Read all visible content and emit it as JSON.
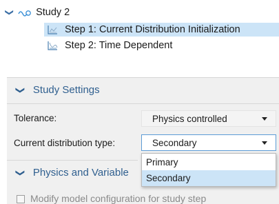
{
  "tree": {
    "study": {
      "label": "Study 2",
      "icon": "study-icon"
    },
    "steps": [
      {
        "label": "Step 1: Current Distribution Initialization",
        "icon": "stationary-step-icon",
        "selected": true
      },
      {
        "label": "Step 2: Time Dependent",
        "icon": "time-dependent-step-icon",
        "selected": false
      }
    ]
  },
  "study_settings": {
    "title": "Study Settings",
    "tolerance_label": "Tolerance:",
    "tolerance_value": "Physics controlled",
    "current_distribution_label": "Current distribution type:",
    "current_distribution_value": "Secondary",
    "options": [
      "Primary",
      "Secondary"
    ]
  },
  "physics_section": {
    "title": "Physics and Variable",
    "checkbox_label": "Modify model configuration for study step"
  },
  "colors": {
    "accent": "#2f5f8f",
    "selection": "#cce4f7",
    "panel_bg": "#f0f0f0",
    "focus_border": "#5b9bd5"
  }
}
